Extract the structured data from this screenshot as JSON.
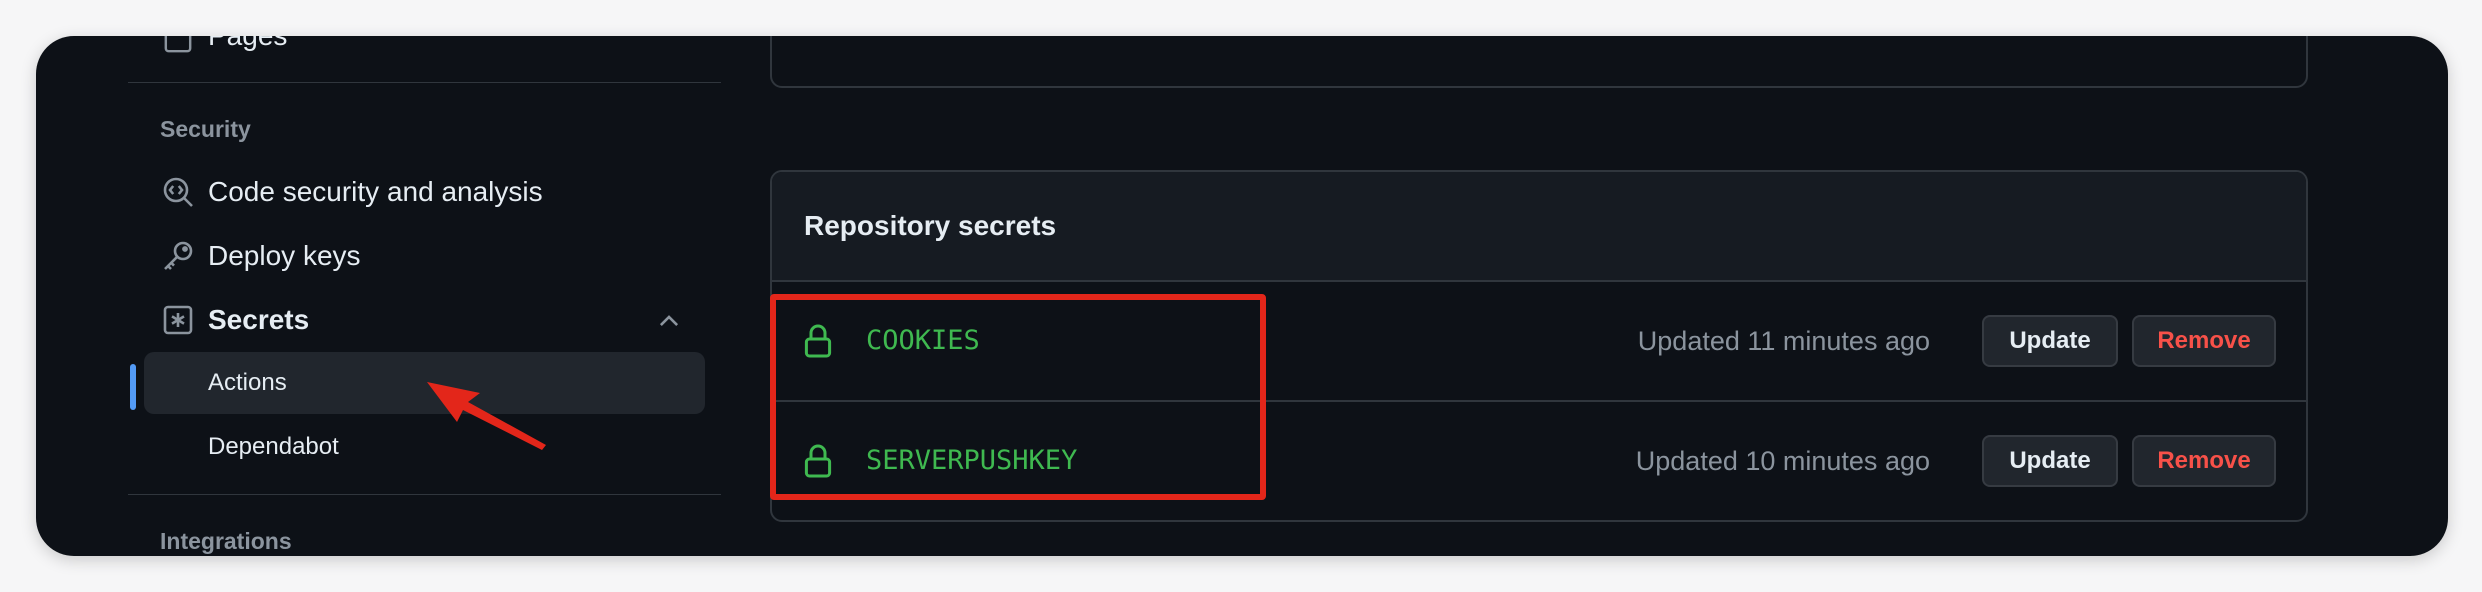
{
  "sidebar": {
    "pages_label": "Pages",
    "security_heading": "Security",
    "code_security_label": "Code security and analysis",
    "deploy_keys_label": "Deploy keys",
    "secrets_label": "Secrets",
    "secrets_subitems": [
      {
        "label": "Actions",
        "active": true
      },
      {
        "label": "Dependabot",
        "active": false
      }
    ],
    "integrations_heading": "Integrations"
  },
  "repository_secrets": {
    "title": "Repository secrets",
    "secrets": [
      {
        "name": "COOKIES",
        "updated": "Updated 11 minutes ago",
        "update_label": "Update",
        "remove_label": "Remove"
      },
      {
        "name": "SERVERPUSHKEY",
        "updated": "Updated 10 minutes ago",
        "update_label": "Update",
        "remove_label": "Remove"
      }
    ]
  },
  "icons": {
    "pages": "file-icon",
    "code_security": "codescan-icon",
    "deploy_keys": "key-icon",
    "secrets": "asterisk-icon",
    "secret_lock": "lock-icon",
    "expand": "chevron-up-icon"
  },
  "colors": {
    "background": "#0d1117",
    "border": "#30363d",
    "secret_name": "#3fb950",
    "active_indicator": "#539bf5",
    "remove_text": "#f85149",
    "annotation_red": "#e3261a"
  }
}
